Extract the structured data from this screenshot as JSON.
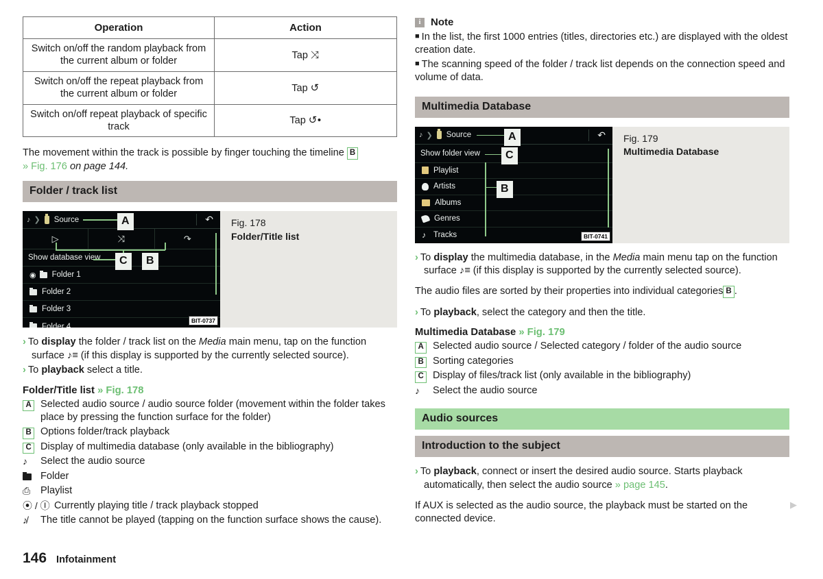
{
  "footer": {
    "page_number": "146",
    "section": "Infotainment"
  },
  "table": {
    "headers": [
      "Operation",
      "Action"
    ],
    "rows": [
      {
        "operation": "Switch on/off the random playback from the current album or folder",
        "action_prefix": "Tap",
        "action_symbol": "⤨"
      },
      {
        "operation": "Switch on/off the repeat playback from the current album or folder",
        "action_prefix": "Tap",
        "action_symbol": "↺"
      },
      {
        "operation": "Switch on/off repeat playback of specific track",
        "action_prefix": "Tap",
        "action_symbol": "↺•"
      }
    ]
  },
  "left": {
    "timeline_para": {
      "text_1": "The movement within the track is possible by finger touching the timeline ",
      "box_b": "B",
      "ref": "» Fig. 176",
      "text_2": " on page 144."
    },
    "header_folder_track_list": "Folder / track list",
    "figure": {
      "caption_number": "Fig. 178",
      "caption_title": "Folder/Title list",
      "bit_code": "BIT-0737",
      "screen": {
        "source_label": "Source",
        "db_view_label": "Show database view",
        "rows": [
          "Folder 1",
          "Folder 2",
          "Folder 3",
          "Folder 4"
        ],
        "callouts": [
          "A",
          "B",
          "C"
        ]
      }
    },
    "instructions": [
      {
        "chev": "›",
        "pre": "To ",
        "bold": "display",
        "post": " the folder / track list on the ",
        "ital": "Media",
        "post2": " main menu, tap on the function surface ♪≡ (if this display is supported by the currently selected source)."
      },
      {
        "chev": "›",
        "pre": "To ",
        "bold": "playback",
        "post": " select a title.",
        "ital": "",
        "post2": ""
      }
    ],
    "legend_title_text": "Folder/Title list ",
    "legend_title_ref": "» Fig. 178",
    "legend": [
      {
        "key": "A",
        "type": "box",
        "text": "Selected audio source / audio source folder (movement within the folder takes place by pressing the function surface for the folder)"
      },
      {
        "key": "B",
        "type": "box",
        "text": "Options folder/track playback"
      },
      {
        "key": "C",
        "type": "box",
        "text": "Display of multimedia database (only available in the bibliography)"
      },
      {
        "key": "♪",
        "type": "glyph",
        "text": "Select the audio source"
      },
      {
        "key": "▬",
        "type": "folder",
        "text": "Folder"
      },
      {
        "key": "⎙",
        "type": "glyph",
        "text": "Playlist"
      },
      {
        "key": "⦿ / Ⓘ",
        "type": "glyph-wide",
        "text": "Currently playing title / track playback stopped"
      },
      {
        "key": "♪̸",
        "type": "glyph",
        "text": "The title cannot be played (tapping on the function surface shows the cause)."
      }
    ]
  },
  "right": {
    "note": {
      "icon_letter": "i",
      "title": "Note",
      "items": [
        "In the list, the first 1000 entries (titles, directories etc.) are displayed with the oldest creation date.",
        "The scanning speed of the folder / track list depends on the connection speed and volume of data."
      ]
    },
    "header_multimedia_database": "Multimedia Database",
    "figure": {
      "caption_number": "Fig. 179",
      "caption_title": "Multimedia Database",
      "bit_code": "BIT-0741",
      "screen": {
        "source_label": "Source",
        "folder_view_label": "Show folder view",
        "rows": [
          "Playlist",
          "Artists",
          "Albums",
          "Genres",
          "Tracks"
        ],
        "callouts": [
          "A",
          "B",
          "C"
        ]
      }
    },
    "instructions_1": [
      {
        "chev": "›",
        "pre": "To ",
        "bold": "display",
        "post": " the multimedia database, in the ",
        "ital": "Media",
        "post2": " main menu tap on the function surface ♪≡ (if this display is supported by the currently selected source)."
      }
    ],
    "sorted_para": {
      "text_1": "The audio files are sorted by their properties into individual categories",
      "box_b": "B",
      "text_2": "."
    },
    "instructions_2": [
      {
        "chev": "›",
        "pre": "To ",
        "bold": "playback",
        "post": ", select the category and then the title.",
        "ital": "",
        "post2": ""
      }
    ],
    "legend_title_text": "Multimedia Database ",
    "legend_title_ref": "» Fig. 179",
    "legend": [
      {
        "key": "A",
        "type": "box",
        "text": "Selected audio source / Selected category / folder of the audio source"
      },
      {
        "key": "B",
        "type": "box",
        "text": "Sorting categories"
      },
      {
        "key": "C",
        "type": "box",
        "text": "Display of files/track list (only available in the bibliography)"
      },
      {
        "key": "♪",
        "type": "glyph",
        "text": "Select the audio source"
      }
    ],
    "header_audio_sources": "Audio sources",
    "header_introduction": "Introduction to the subject",
    "instructions_3": [
      {
        "chev": "›",
        "pre": "To ",
        "bold": "playback",
        "post": ", connect or insert the desired audio source. Starts playback automatically, then select the audio source ",
        "ref": "» page 145",
        "post2": "."
      }
    ],
    "aux_para": "If AUX is selected as the audio source, the playback must be started on the connected device."
  },
  "colors": {
    "accent_green": "#6dbf73",
    "header_gray": "#bdb7b3",
    "header_green": "#a7dba5",
    "figure_bg": "#e9e8e4"
  }
}
